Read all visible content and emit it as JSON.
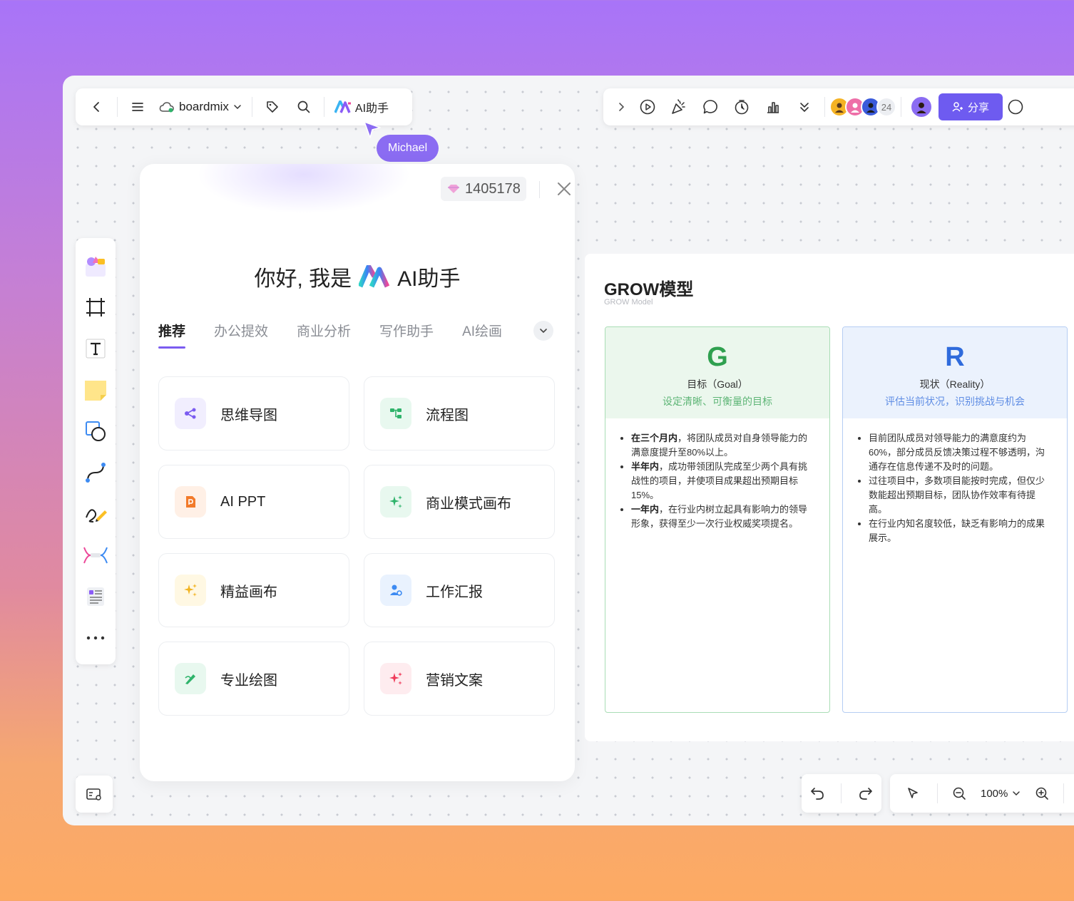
{
  "toolbar_left": {
    "brand": "boardmix",
    "ai_label": "AI助手"
  },
  "cursor": {
    "user": "Michael"
  },
  "toolbar_right": {
    "member_count": "24",
    "share_label": "分享"
  },
  "ai_panel": {
    "credits": "1405178",
    "greeting_prefix": "你好, 我是",
    "greeting_suffix": "AI助手",
    "tabs": [
      "推荐",
      "办公提效",
      "商业分析",
      "写作助手",
      "AI绘画"
    ],
    "cards": [
      {
        "label": "思维导图",
        "icon": "mindmap-icon",
        "color": "#7b5cf0",
        "bg": "#f1eefe"
      },
      {
        "label": "流程图",
        "icon": "flowchart-icon",
        "color": "#2fb36b",
        "bg": "#e8f8ef"
      },
      {
        "label": "AI PPT",
        "icon": "ppt-icon",
        "color": "#f27a2a",
        "bg": "#fff0e6"
      },
      {
        "label": "商业模式画布",
        "icon": "sparkle-icon",
        "color": "#2fb36b",
        "bg": "#e8f8ef"
      },
      {
        "label": "精益画布",
        "icon": "sparkle-icon",
        "color": "#f2b320",
        "bg": "#fff8e3"
      },
      {
        "label": "工作汇报",
        "icon": "report-icon",
        "color": "#3d8bf2",
        "bg": "#e9f2fe"
      },
      {
        "label": "专业绘图",
        "icon": "draw-icon",
        "color": "#2fb36b",
        "bg": "#e8f8ef"
      },
      {
        "label": "营销文案",
        "icon": "sparkle-icon",
        "color": "#ef3b5a",
        "bg": "#feecef"
      }
    ]
  },
  "grow": {
    "title": "GROW模型",
    "subtitle": "GROW Model",
    "cards": [
      {
        "letter": "G",
        "label": "目标（Goal）",
        "desc": "设定清晰、可衡量的目标",
        "accent": "#2fa04f",
        "head_bg": "#ebf7ed",
        "border": "#a9ddb5",
        "items": [
          {
            "bold": "在三个月内",
            "text": "，将团队成员对自身领导能力的满意度提升至80%以上。"
          },
          {
            "bold": "半年内",
            "text": "，成功带领团队完成至少两个具有挑战性的项目，并使项目成果超出预期目标15%。"
          },
          {
            "bold": "一年内",
            "text": "，在行业内树立起具有影响力的领导形象，获得至少一次行业权威奖项提名。"
          }
        ]
      },
      {
        "letter": "R",
        "label": "现状（Reality）",
        "desc": "评估当前状况，识别挑战与机会",
        "accent": "#2f6bdc",
        "head_bg": "#ebf2fd",
        "border": "#b5cdf3",
        "items": [
          {
            "bold": "",
            "text": "目前团队成员对领导能力的满意度约为60%，部分成员反馈决策过程不够透明，沟通存在信息传递不及时的问题。"
          },
          {
            "bold": "",
            "text": "过往项目中，多数项目能按时完成，但仅少数能超出预期目标，团队协作效率有待提高。"
          },
          {
            "bold": "",
            "text": "在行业内知名度较低，缺乏有影响力的成果展示。"
          }
        ]
      }
    ]
  },
  "zoom": {
    "value": "100%"
  }
}
